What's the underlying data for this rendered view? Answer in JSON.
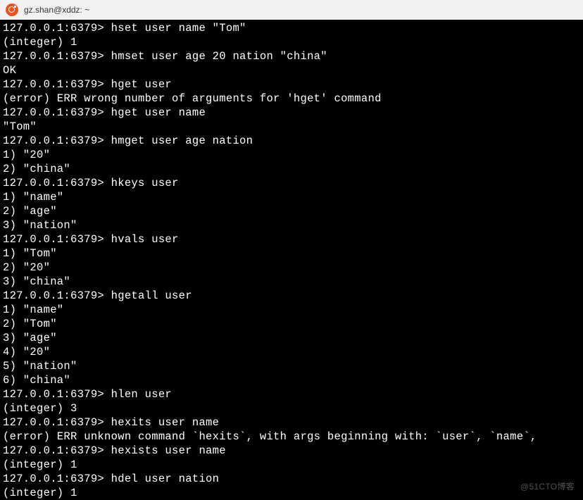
{
  "window": {
    "title": "gz.shan@xddz: ~"
  },
  "prompt": "127.0.0.1:6379>",
  "session": [
    {
      "type": "cmd",
      "text": "hset user name \"Tom\""
    },
    {
      "type": "out",
      "text": "(integer) 1"
    },
    {
      "type": "cmd",
      "text": "hmset user age 20 nation \"china\""
    },
    {
      "type": "out",
      "text": "OK"
    },
    {
      "type": "cmd",
      "text": "hget user"
    },
    {
      "type": "out",
      "text": "(error) ERR wrong number of arguments for 'hget' command"
    },
    {
      "type": "cmd",
      "text": "hget user name"
    },
    {
      "type": "out",
      "text": "\"Tom\""
    },
    {
      "type": "cmd",
      "text": "hmget user age nation"
    },
    {
      "type": "out",
      "text": "1) \"20\""
    },
    {
      "type": "out",
      "text": "2) \"china\""
    },
    {
      "type": "cmd",
      "text": "hkeys user"
    },
    {
      "type": "out",
      "text": "1) \"name\""
    },
    {
      "type": "out",
      "text": "2) \"age\""
    },
    {
      "type": "out",
      "text": "3) \"nation\""
    },
    {
      "type": "cmd",
      "text": "hvals user"
    },
    {
      "type": "out",
      "text": "1) \"Tom\""
    },
    {
      "type": "out",
      "text": "2) \"20\""
    },
    {
      "type": "out",
      "text": "3) \"china\""
    },
    {
      "type": "cmd",
      "text": "hgetall user"
    },
    {
      "type": "out",
      "text": "1) \"name\""
    },
    {
      "type": "out",
      "text": "2) \"Tom\""
    },
    {
      "type": "out",
      "text": "3) \"age\""
    },
    {
      "type": "out",
      "text": "4) \"20\""
    },
    {
      "type": "out",
      "text": "5) \"nation\""
    },
    {
      "type": "out",
      "text": "6) \"china\""
    },
    {
      "type": "cmd",
      "text": "hlen user"
    },
    {
      "type": "out",
      "text": "(integer) 3"
    },
    {
      "type": "cmd",
      "text": "hexits user name"
    },
    {
      "type": "out",
      "text": "(error) ERR unknown command `hexits`, with args beginning with: `user`, `name`, "
    },
    {
      "type": "cmd",
      "text": "hexists user name"
    },
    {
      "type": "out",
      "text": "(integer) 1"
    },
    {
      "type": "cmd",
      "text": "hdel user nation"
    },
    {
      "type": "out",
      "text": "(integer) 1"
    }
  ],
  "watermark": "@51CTO博客"
}
